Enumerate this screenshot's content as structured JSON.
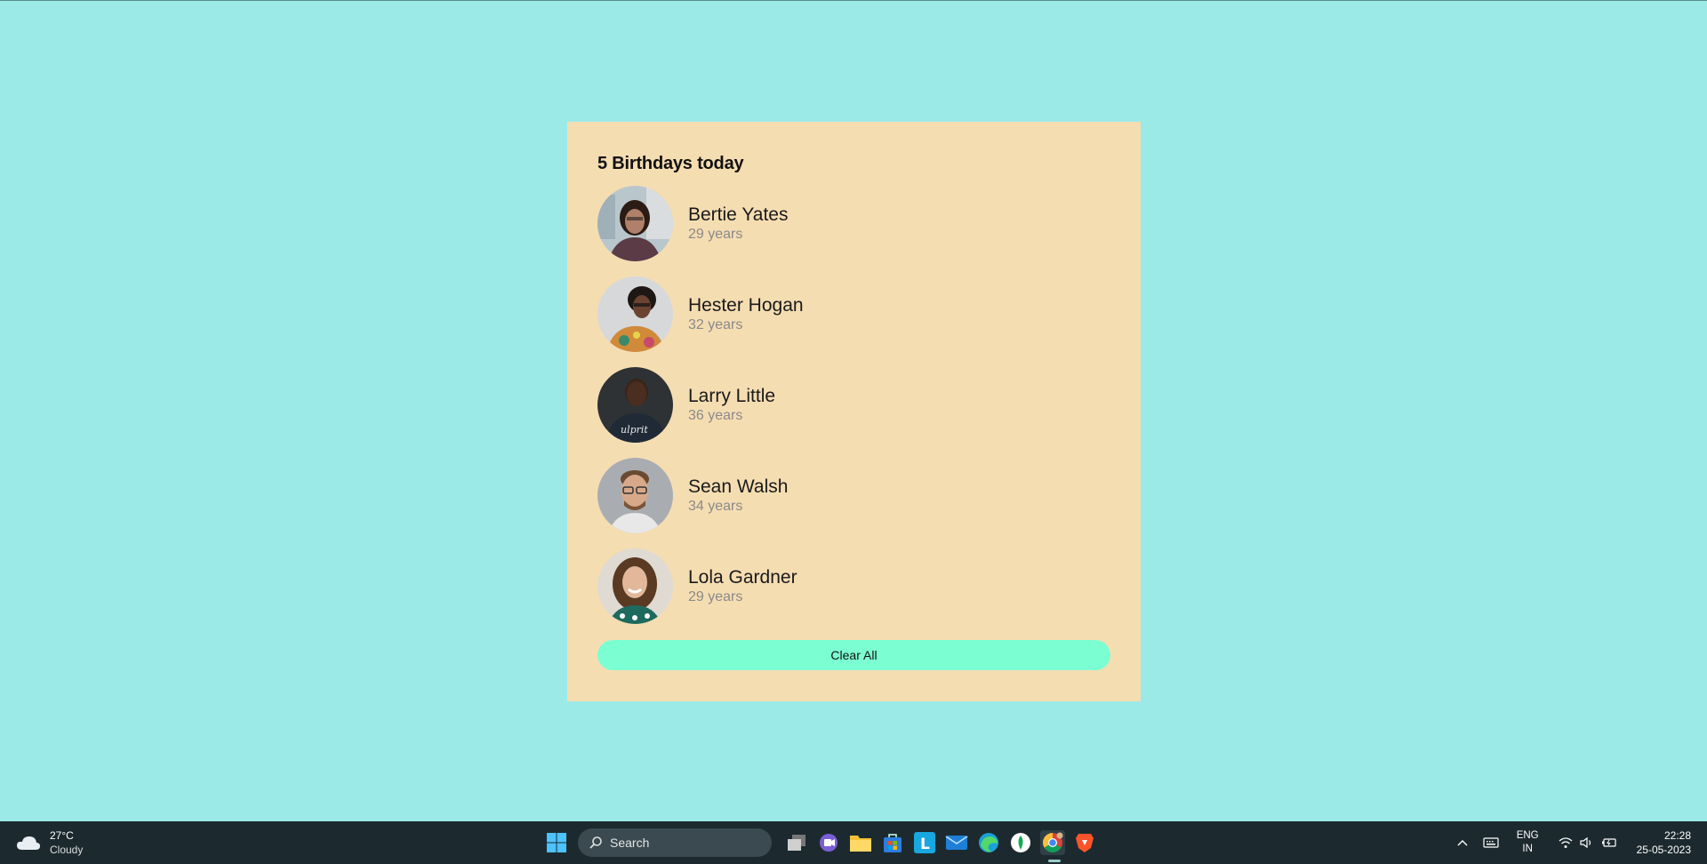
{
  "card": {
    "title": "5 Birthdays today",
    "people": [
      {
        "name": "Bertie Yates",
        "age": "29 years"
      },
      {
        "name": "Hester Hogan",
        "age": "32 years"
      },
      {
        "name": "Larry Little",
        "age": "36 years"
      },
      {
        "name": "Sean Walsh",
        "age": "34 years"
      },
      {
        "name": "Lola Gardner",
        "age": "29 years"
      }
    ],
    "clear_label": "Clear All"
  },
  "taskbar": {
    "weather": {
      "temp": "27°C",
      "condition": "Cloudy",
      "icon": "cloud-icon"
    },
    "search_placeholder": "Search",
    "lang_line1": "ENG",
    "lang_line2": "IN",
    "time": "22:28",
    "date": "25-05-2023"
  },
  "colors": {
    "background": "#9beae8",
    "card": "#f5ddb2",
    "button": "#7bffd2",
    "taskbar": "#1c2a2f"
  }
}
